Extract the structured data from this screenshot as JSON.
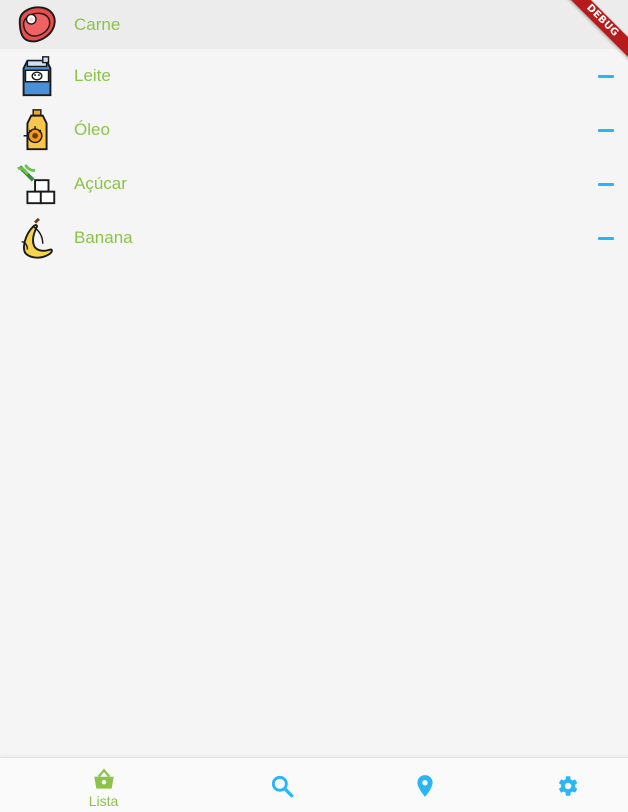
{
  "list": {
    "items": [
      {
        "label": "Carne",
        "icon": "steak-icon",
        "highlighted": true
      },
      {
        "label": "Leite",
        "icon": "milk-carton-icon",
        "action": "minus"
      },
      {
        "label": "Óleo",
        "icon": "oil-bottle-icon",
        "action": "minus"
      },
      {
        "label": "Açúcar",
        "icon": "sugar-cubes-icon",
        "action": "minus"
      },
      {
        "label": "Banana",
        "icon": "banana-icon",
        "action": "minus"
      }
    ]
  },
  "debug_banner": "DEBUG",
  "bottom_nav": {
    "items": [
      {
        "label": "Lista",
        "icon": "basket-icon",
        "active": true
      },
      {
        "icon": "search-icon"
      },
      {
        "icon": "location-pin-icon"
      },
      {
        "icon": "gear-icon"
      }
    ]
  },
  "colors": {
    "label_green": "#8bc34a",
    "minus_blue": "#29b6f6",
    "background": "#f5f5f5",
    "debug_red": "#b71c1c"
  }
}
